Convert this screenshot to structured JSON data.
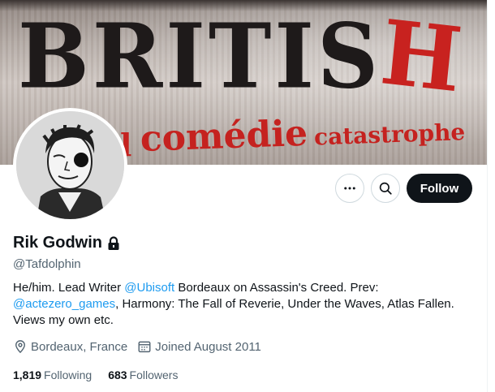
{
  "banner": {
    "title_main": "BRITIS",
    "title_red": "H",
    "subtitle_prefix": "l",
    "subtitle_big": "comédie",
    "subtitle_small": "catastrophe"
  },
  "profile": {
    "display_name": "Rik Godwin",
    "handle": "@Tafdolphin",
    "bio_part1": "He/him. Lead Writer ",
    "bio_mention1": "@Ubisoft",
    "bio_part2": " Bordeaux on Assassin's Creed. Prev: ",
    "bio_mention2": "@actezero_games",
    "bio_part3": ", Harmony: The Fall of Reverie, Under the Waves, Atlas Fallen. Views my own etc.",
    "location": "Bordeaux, France",
    "joined": "Joined August 2011",
    "following_count": "1,819",
    "following_label": "Following",
    "followers_count": "683",
    "followers_label": "Followers"
  },
  "actions": {
    "follow_label": "Follow"
  },
  "icons": {
    "more": "more-horizontal-icon",
    "search": "search-icon",
    "lock": "lock-icon",
    "location": "location-pin-icon",
    "calendar": "calendar-icon"
  },
  "colors": {
    "accent": "#1d9bf0",
    "follow_bg": "#0f1419",
    "secondary_text": "#536471",
    "banner_red": "#c8221f"
  }
}
